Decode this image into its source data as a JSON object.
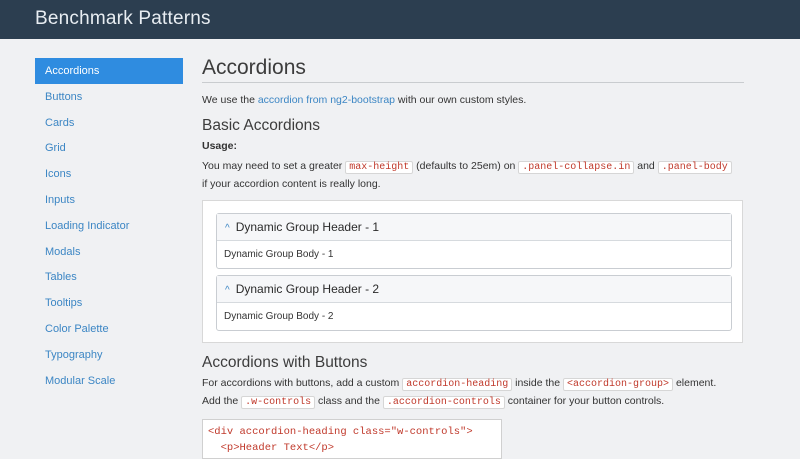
{
  "header": {
    "title": "Benchmark Patterns"
  },
  "sidebar": {
    "items": [
      {
        "label": "Accordions",
        "active": true
      },
      {
        "label": "Buttons"
      },
      {
        "label": "Cards"
      },
      {
        "label": "Grid"
      },
      {
        "label": "Icons"
      },
      {
        "label": "Inputs"
      },
      {
        "label": "Loading Indicator"
      },
      {
        "label": "Modals"
      },
      {
        "label": "Tables"
      },
      {
        "label": "Tooltips"
      },
      {
        "label": "Color Palette"
      },
      {
        "label": "Typography"
      },
      {
        "label": "Modular Scale"
      }
    ]
  },
  "main": {
    "title": "Accordions",
    "intro": {
      "before": "We use the ",
      "link": "accordion from ng2-bootstrap",
      "after": " with our own custom styles."
    },
    "basic": {
      "heading": "Basic Accordions",
      "usage_label": "Usage:",
      "text1": "You may need to set a greater ",
      "code1": "max-height",
      "text2": " (defaults to 25em) on ",
      "code2": ".panel-collapse.in",
      "text3": " and ",
      "code3": ".panel-body",
      "text4": "if your accordion content is really long.",
      "groups": [
        {
          "header": "Dynamic Group Header - 1",
          "body": "Dynamic Group Body - 1"
        },
        {
          "header": "Dynamic Group Header - 2",
          "body": "Dynamic Group Body - 2"
        }
      ]
    },
    "buttons": {
      "heading": "Accordions with Buttons",
      "t1": "For accordions with buttons, add a custom ",
      "c1": "accordion-heading",
      "t2": " inside the ",
      "c2": "<accordion-group>",
      "t3": " element.",
      "t4": "Add the ",
      "c3": ".w-controls",
      "t5": " class and the ",
      "c4": ".accordion-controls",
      "t6": " container for your button controls.",
      "code_lines": [
        "<div accordion-heading class=\"w-controls\">",
        "  <p>Header Text</p>"
      ]
    }
  },
  "colors": {
    "topbar": "#2c3e50",
    "active_nav": "#2f8ce0",
    "link": "#3c86c4",
    "code": "#c0392b"
  }
}
